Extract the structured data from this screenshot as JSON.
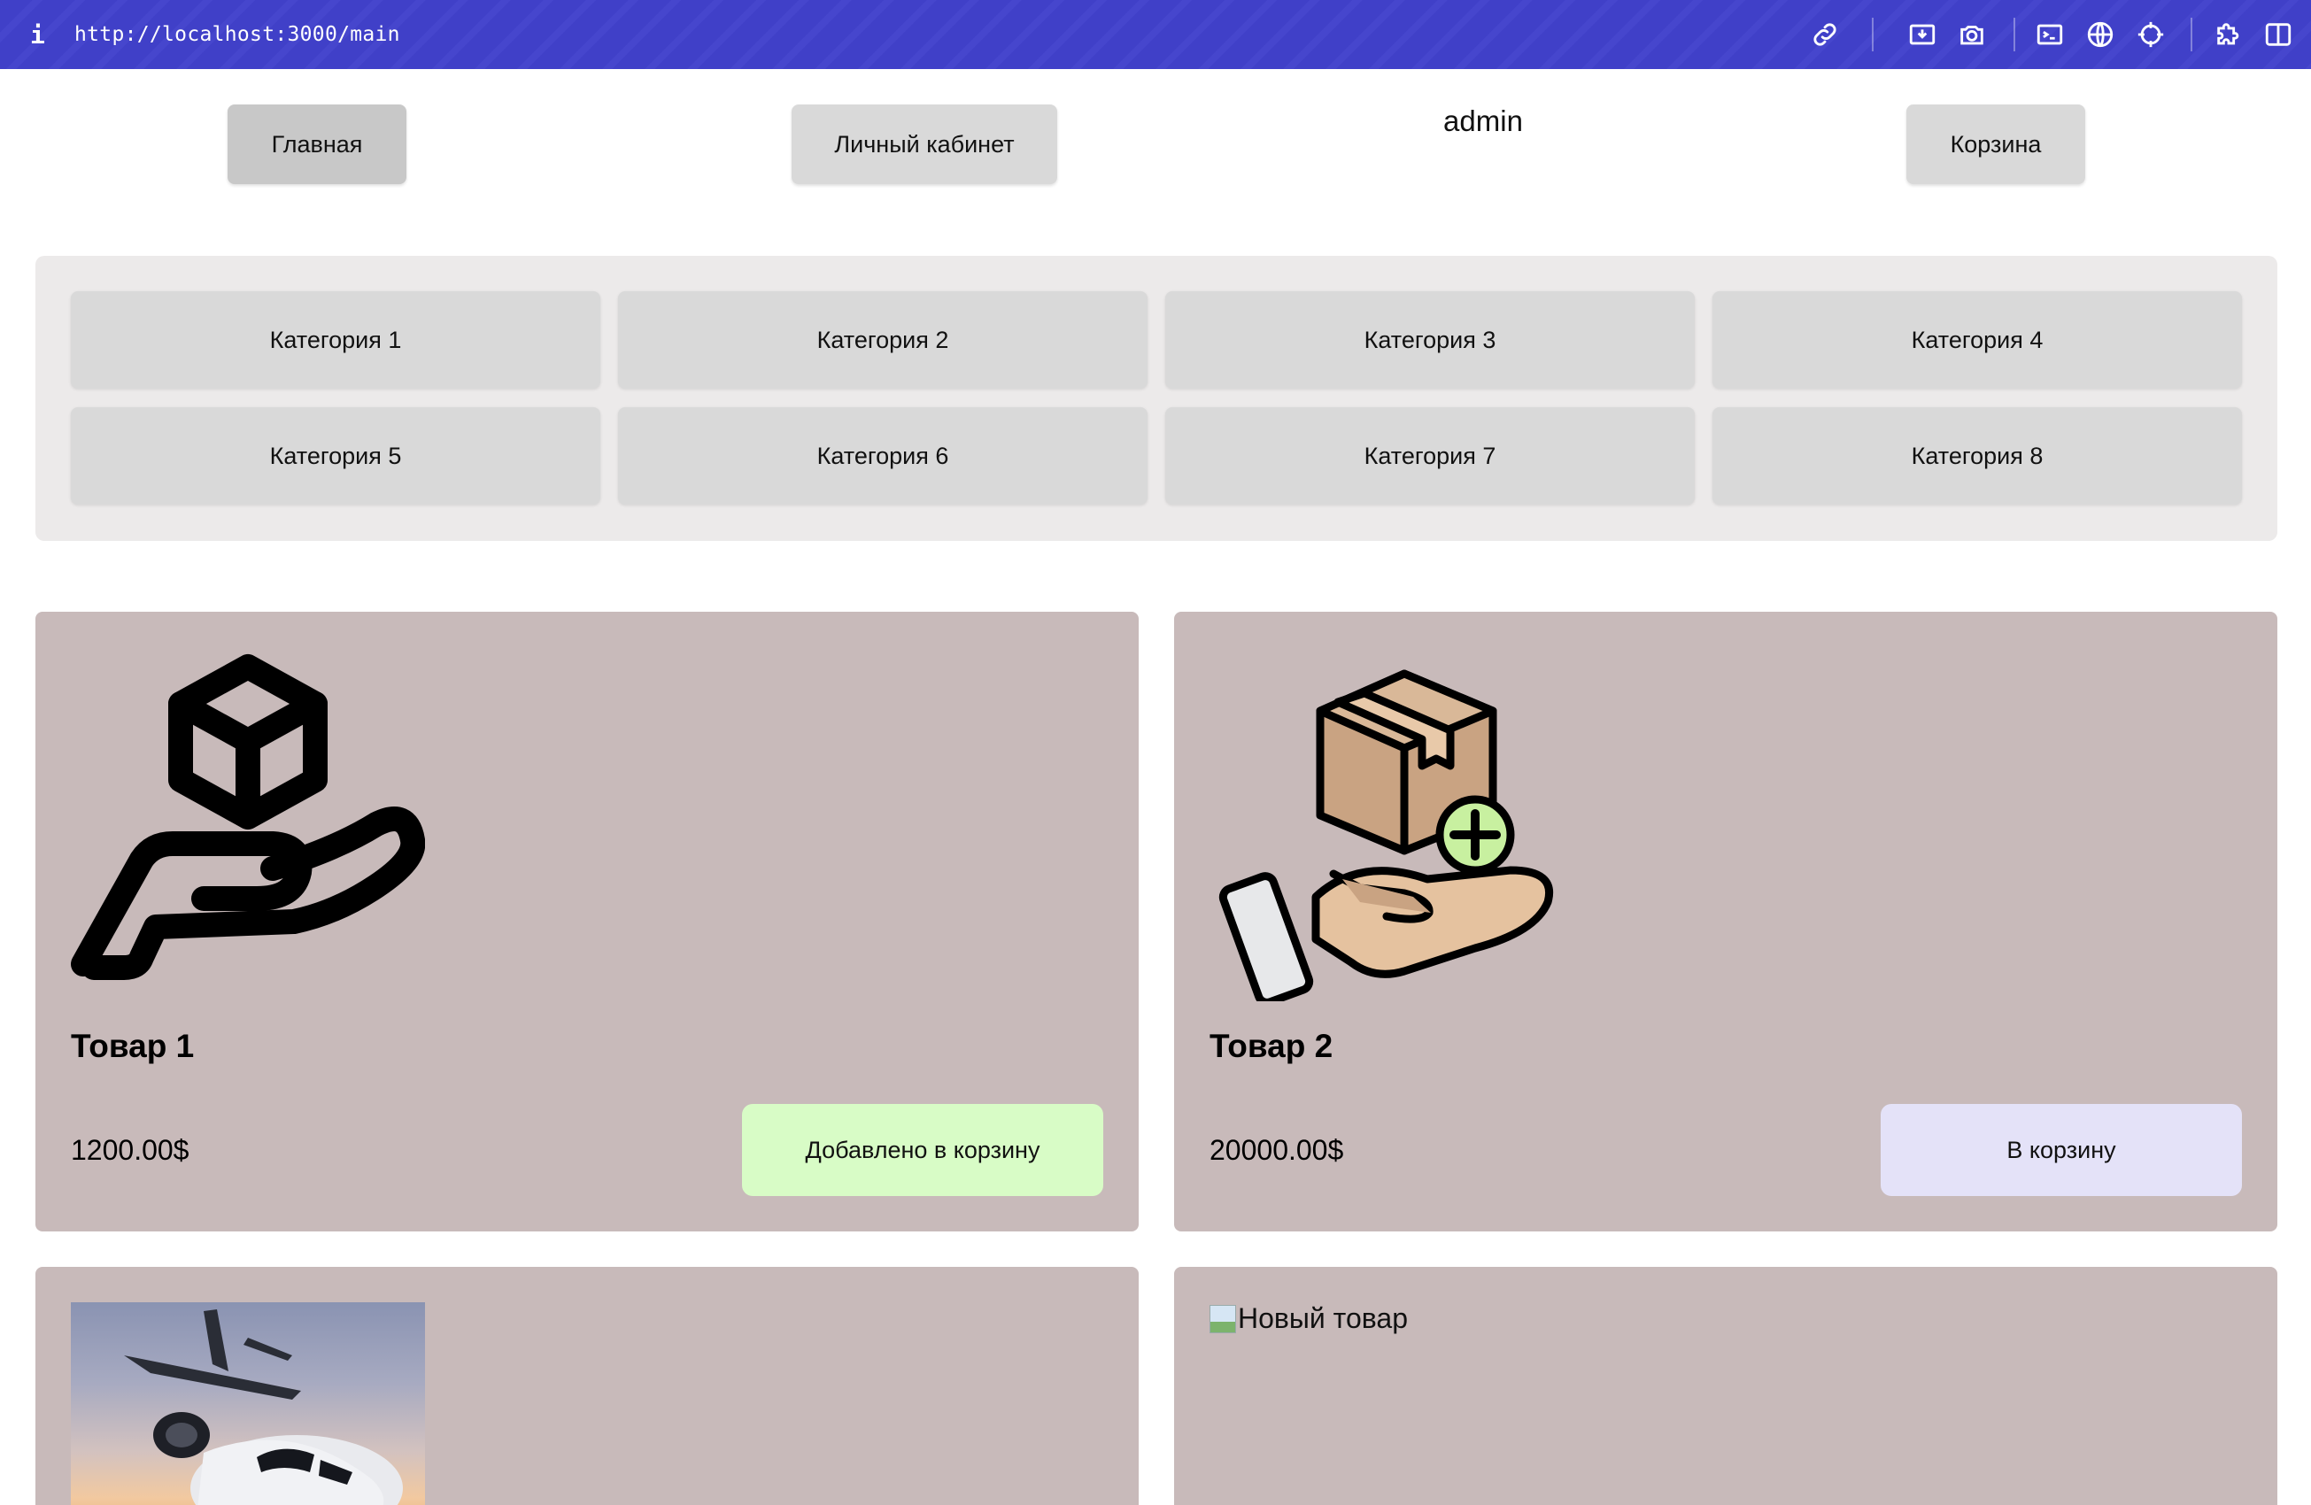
{
  "browser": {
    "url": "http://localhost:3000/main",
    "info_icon": "i",
    "icons": [
      "link-icon",
      "screenshot-icon",
      "camera-icon",
      "terminal-icon",
      "globe-icon",
      "crosshair-icon",
      "extension-icon",
      "sidebar-icon"
    ]
  },
  "nav": {
    "home": "Главная",
    "account": "Личный кабинет",
    "username": "admin",
    "cart": "Корзина"
  },
  "categories": [
    "Категория 1",
    "Категория 2",
    "Категория 3",
    "Категория 4",
    "Категория 5",
    "Категория 6",
    "Категория 7",
    "Категория 8"
  ],
  "products": [
    {
      "title": "Товар 1",
      "price": "1200.00$",
      "button": "Добавлено в корзину",
      "image": "box-on-hand-outline-icon"
    },
    {
      "title": "Товар 2",
      "price": "20000.00$",
      "button": "В корзину",
      "image": "box-on-hand-add-icon"
    },
    {
      "image": "airplane-photo"
    },
    {
      "image_alt": "Новый товар"
    }
  ],
  "colors": {
    "browser_bar": "#4040c8",
    "card_bg": "#c8baba",
    "added_button": "#d8fcc6",
    "cart_button": "#e4e2f8",
    "category_panel": "#eceaea",
    "button_grey": "#d9d9d9"
  }
}
